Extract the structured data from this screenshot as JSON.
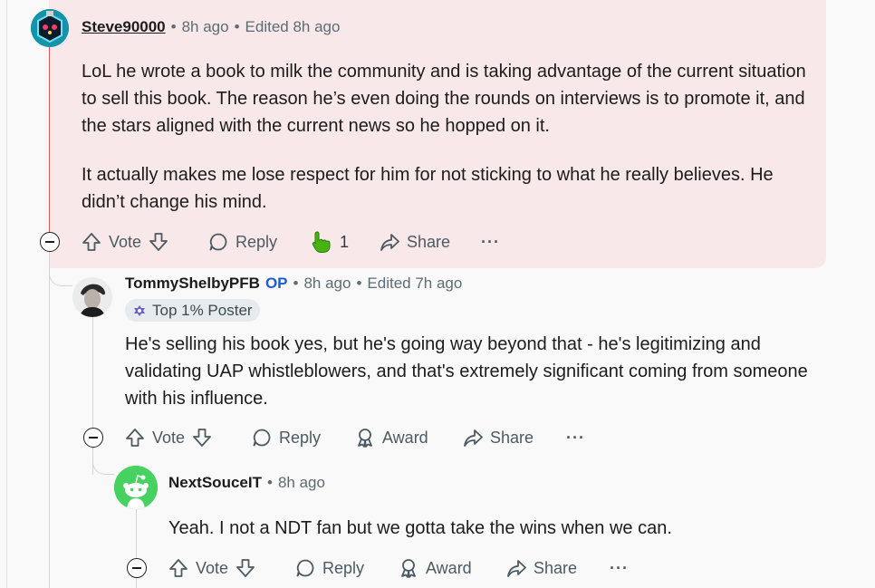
{
  "comments": [
    {
      "username": "Steve90000",
      "time": "8h ago",
      "edited": "Edited 8h ago",
      "paragraphs": [
        "LoL he wrote a book to milk the community and is taking advantage of the current situation to sell this book. The reason he’s even doing the rounds on interviews is to promote it, and the stars aligned with the current news so he hopped on it.",
        "It actually makes me lose respect for him for not sticking to what he really believes. He didn’t change his mind."
      ],
      "actions": {
        "vote": "Vote",
        "reply": "Reply",
        "award_count": "1",
        "share": "Share",
        "more": "···"
      },
      "highlight_color": "#f8e8e9"
    },
    {
      "username": "TommyShelbyPFB",
      "op_label": "OP",
      "time": "8h ago",
      "edited": "Edited 7h ago",
      "flair": "Top 1% Poster",
      "paragraphs": [
        "He's selling his book yes, but he's going way beyond that - he's legitimizing and validating UAP whistleblowers, and that's extremely significant coming from someone with his influence."
      ],
      "actions": {
        "vote": "Vote",
        "reply": "Reply",
        "award": "Award",
        "share": "Share",
        "more": "···"
      }
    },
    {
      "username": "NextSouceIT",
      "time": "8h ago",
      "paragraphs": [
        "Yeah. I not a NDT fan but we gotta take the wins when we can."
      ],
      "actions": {
        "vote": "Vote",
        "reply": "Reply",
        "award": "Award",
        "share": "Share",
        "more": "···"
      }
    }
  ],
  "separator": "•",
  "colors": {
    "op": "#1d5bd8",
    "award_hand": "#46b312",
    "avatar_green": "#46d160"
  }
}
